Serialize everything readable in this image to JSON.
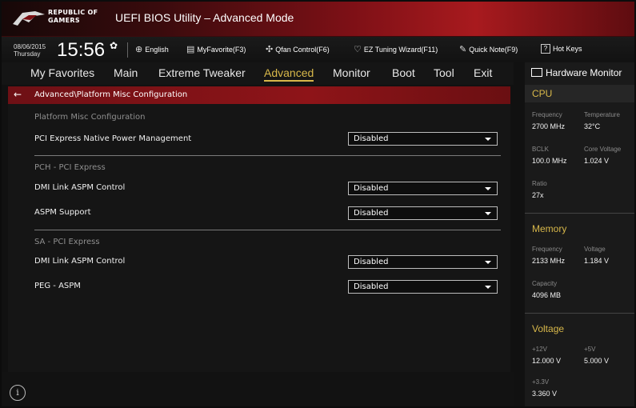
{
  "titlebar": {
    "brand_line1": "REPUBLIC OF",
    "brand_line2": "GAMERS",
    "title": "UEFI BIOS Utility – Advanced Mode"
  },
  "infobar": {
    "date": "08/06/2015",
    "day": "Thursday",
    "time": "15:56",
    "tools": [
      {
        "icon": "globe-icon",
        "label": "English"
      },
      {
        "icon": "star-icon",
        "label": "MyFavorite(F3)"
      },
      {
        "icon": "fan-icon",
        "label": "Qfan Control(F6)"
      },
      {
        "icon": "bulb-icon",
        "label": "EZ Tuning Wizard(F11)"
      },
      {
        "icon": "note-icon",
        "label": "Quick Note(F9)"
      },
      {
        "icon": "question-icon",
        "label": "Hot Keys"
      }
    ]
  },
  "menu": {
    "items": [
      "My Favorites",
      "Main",
      "Extreme Tweaker",
      "Advanced",
      "Monitor",
      "Boot",
      "Tool",
      "Exit"
    ],
    "active": "Advanced"
  },
  "breadcrumb": "Advanced\\Platform Misc Configuration",
  "main": {
    "section1": "Platform Misc Configuration",
    "pci_native_label": "PCI Express Native Power Management",
    "pci_native_value": "Disabled",
    "section2": "PCH - PCI Express",
    "pch_dmi_label": "DMI Link ASPM Control",
    "pch_dmi_value": "Disabled",
    "aspm_label": "ASPM Support",
    "aspm_value": "Disabled",
    "section3": "SA - PCI Express",
    "sa_dmi_label": "DMI Link ASPM Control",
    "sa_dmi_value": "Disabled",
    "peg_label": "PEG - ASPM",
    "peg_value": "Disabled"
  },
  "hw_monitor": {
    "title": "Hardware Monitor",
    "cpu": {
      "heading": "CPU",
      "freq_label": "Frequency",
      "freq_value": "2700 MHz",
      "temp_label": "Temperature",
      "temp_value": "32°C",
      "bclk_label": "BCLK",
      "bclk_value": "100.0 MHz",
      "core_label": "Core Voltage",
      "core_value": "1.024 V",
      "ratio_label": "Ratio",
      "ratio_value": "27x"
    },
    "memory": {
      "heading": "Memory",
      "freq_label": "Frequency",
      "freq_value": "2133 MHz",
      "volt_label": "Voltage",
      "volt_value": "1.184 V",
      "cap_label": "Capacity",
      "cap_value": "4096 MB"
    },
    "voltage": {
      "heading": "Voltage",
      "v12_label": "+12V",
      "v12_value": "12.000 V",
      "v5_label": "+5V",
      "v5_value": "5.000 V",
      "v33_label": "+3.3V",
      "v33_value": "3.360 V"
    }
  },
  "colors": {
    "accent": "#d8b84a",
    "title_red": "#a81a1e",
    "breadcrumb_red": "#8e1418"
  }
}
